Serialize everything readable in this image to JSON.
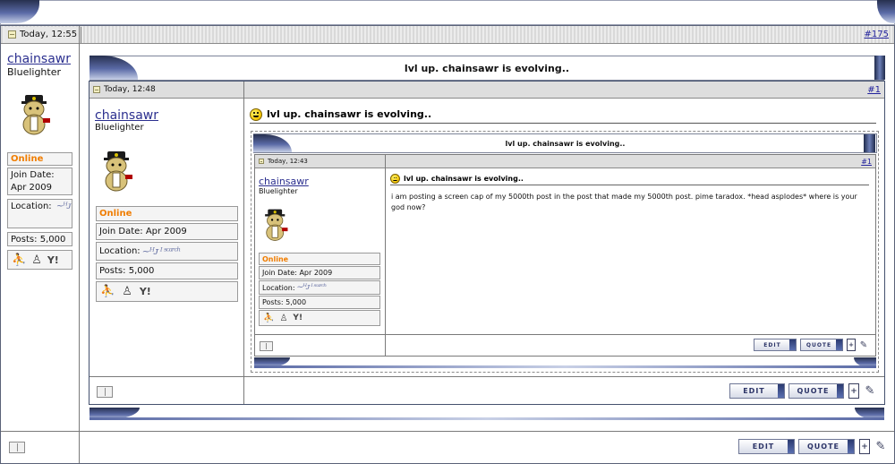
{
  "outer": {
    "date": "Today, 12:55",
    "post_number": "#175",
    "username": "chainsawr",
    "user_title": "Bluelighter",
    "status": "Online",
    "join_label": "Join Date:",
    "join_value": "Apr 2009",
    "location_label": "Location:",
    "posts_label": "Posts:",
    "posts_value": "5,000",
    "edit_label": "EDIT",
    "quote_label": "QUOTE"
  },
  "quote1": {
    "title": "lvl up. chainsawr is evolving..",
    "date": "Today, 12:48",
    "post_number": "#1",
    "username": "chainsawr",
    "user_title": "Bluelighter",
    "status": "Online",
    "join_label": "Join Date:",
    "join_value": "Apr 2009",
    "location_label": "Location:",
    "posts_label": "Posts:",
    "posts_value": "5,000",
    "post_title": "lvl up. chainsawr is evolving..",
    "edit_label": "EDIT",
    "quote_label": "QUOTE"
  },
  "quote2": {
    "title": "lvl up. chainsawr is evolving..",
    "date": "Today, 12:43",
    "post_number": "#1",
    "username": "chainsawr",
    "user_title": "Bluelighter",
    "status": "Online",
    "join_label": "Join Date:",
    "join_value": "Apr 2009",
    "location_label": "Location:",
    "posts_label": "Posts:",
    "posts_value": "5,000",
    "post_title": "lvl up. chainsawr is evolving..",
    "body": "i am posting a screen cap of my 5000th post in the post that made my 5000th post. pime taradox. *head asplodes* where is your god now?",
    "edit_label": "EDIT",
    "quote_label": "QUOTE"
  },
  "icons": {
    "contact_1": "aim-icon",
    "contact_2": "msn-icon",
    "contact_3": "yahoo-icon",
    "multiquote": "multiquote-icon",
    "report": "report-post-icon",
    "post": "post-page-icon"
  },
  "colors": {
    "frame_blue": "#44516e",
    "username_blue": "#2b2f8f",
    "online_orange": "#f07d00",
    "header_grey": "#dedede"
  }
}
